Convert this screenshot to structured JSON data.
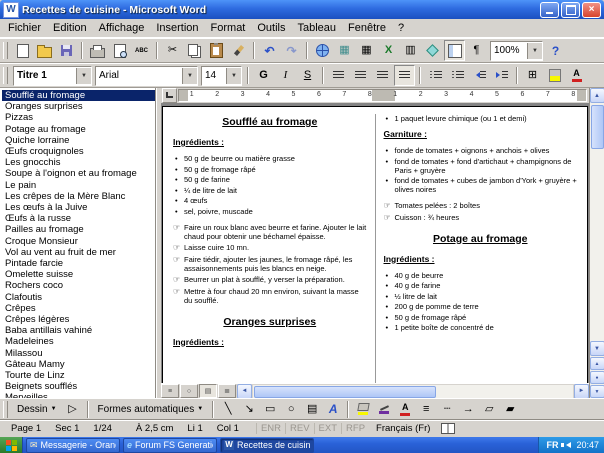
{
  "window": {
    "title": "Recettes de cuisine - Microsoft Word"
  },
  "glyphs": {
    "word": "W",
    "close": "×",
    "dropdown": "▼",
    "spelling": "ABC",
    "cut": "✂",
    "undo": "↶",
    "redo": "↷",
    "table": "▦",
    "columns": "▥",
    "excel": "X",
    "paragraph": "¶",
    "help": "?",
    "borders": "⊞",
    "bold": "G",
    "italic": "I",
    "underline": "S",
    "pointer": "▷",
    "line": "╲",
    "arrow": "↘",
    "rect": "▭",
    "oval": "○",
    "textbox": "▤",
    "wordart": "A",
    "linestyle": "≡",
    "dashstyle": "┄",
    "arrowstyle": "→",
    "shadow": "▱",
    "threed": "▰",
    "fontcolor": "A",
    "view_normal": "≡",
    "view_web": "○",
    "view_print": "▤",
    "view_outline": "≣",
    "up_arrow": "▲",
    "down_arrow": "▼",
    "left_arrow": "◄",
    "right_arrow": "►",
    "browse_prev": "▲",
    "browse_select": "●",
    "browse_next": "▼",
    "bullet": "•",
    "step": "☞",
    "envelope": "✉",
    "ie": "e"
  },
  "menu": {
    "items": [
      "Fichier",
      "Edition",
      "Affichage",
      "Insertion",
      "Format",
      "Outils",
      "Tableau",
      "Fenêtre",
      "?"
    ]
  },
  "toolbar_standard": {
    "zoom": "100%"
  },
  "toolbar_format": {
    "style": "Titre 1",
    "font": "Arial",
    "size": "14"
  },
  "document_map": {
    "selected_index": 0,
    "items": [
      "Soufflé au fromage",
      "Oranges surprises",
      "Pizzas",
      "Potage au fromage",
      "Quiche lorraine",
      "Œufs croquignoles",
      "Les gnocchis",
      "Soupe à l'oignon et au fromage",
      "Le pain",
      "Les crêpes de la Mère Blanc",
      "Les œufs à la Juive",
      "Œufs à la russe",
      "Pailles au fromage",
      "Croque Monsieur",
      "Vol au vent au fruit de mer",
      "Pintade farcie",
      "Omelette suisse",
      "Rochers coco",
      "Clafoutis",
      "Crêpes",
      "Crêpes légères",
      "Baba antillais vahiné",
      "Madeleines",
      "Milassou",
      "Gâteau Mamy",
      "Tourte de Linz",
      "Beignets soufflés",
      "Merveilles"
    ]
  },
  "ruler": {
    "numbers": [
      "1",
      "2",
      "3",
      "4",
      "5",
      "6",
      "7",
      "8",
      "1",
      "2",
      "3",
      "4",
      "5",
      "6",
      "7",
      "8"
    ]
  },
  "doc": {
    "left": {
      "title": "Soufflé au fromage",
      "ingredients_heading": "Ingrédients :",
      "ingredients": [
        "50 g de beurre ou matière grasse",
        "50 g de fromage râpé",
        "50 g de farine",
        "¼ de litre de lait",
        "4 œufs",
        "sel, poivre, muscade"
      ],
      "steps": [
        "Faire un roux blanc avec beurre et farine. Ajouter le lait chaud pour obtenir une béchamel épaisse.",
        "Laisse cuire 10 mn.",
        "Faire tiédir, ajouter les jaunes, le fromage râpé, les assaisonnements puis les blancs en neige.",
        "Beurrer un plat à soufflé, y verser la préparation.",
        "Mettre à four chaud 20 mn environ, suivant la masse du soufflé."
      ],
      "next_title": "Oranges surprises",
      "next_heading": "Ingrédients :"
    },
    "right": {
      "carryover": [
        "1 paquet levure chimique (ou 1 et demi)"
      ],
      "garniture_heading": "Garniture :",
      "garniture": [
        "fonde de tomates + oignons + anchois + olives",
        "fond de tomates + fond d'artichaut + champignons de Paris + gruyère",
        "fond de tomates + cubes de jambon d'York + gruyère + olives noires"
      ],
      "notes": [
        "Tomates pelées : 2 boîtes",
        "Cuisson : ¾ heures"
      ],
      "title": "Potage au fromage",
      "ingredients_heading": "Ingrédients :",
      "ingredients": [
        "40 g de beurre",
        "40 g de farine",
        "½ litre de lait",
        "200 g de pomme de terre",
        "50 g de fromage râpé",
        "1 petite boîte de concentré de"
      ]
    }
  },
  "drawing": {
    "menu": "Dessin",
    "autoshapes": "Formes automatiques"
  },
  "status": {
    "page": "Page 1",
    "section": "Sec 1",
    "position": "1/24",
    "at": "À 2,5 cm",
    "line": "Li 1",
    "column": "Col 1",
    "flags": [
      "ENR",
      "REV",
      "EXT",
      "RFP"
    ],
    "language": "Français (Fr)"
  },
  "taskbar": {
    "buttons": [
      "Messagerie - Orang...",
      "Forum FS Generatio...",
      "Recettes de cuisine ..."
    ],
    "language": "FR",
    "time": "20:47"
  }
}
